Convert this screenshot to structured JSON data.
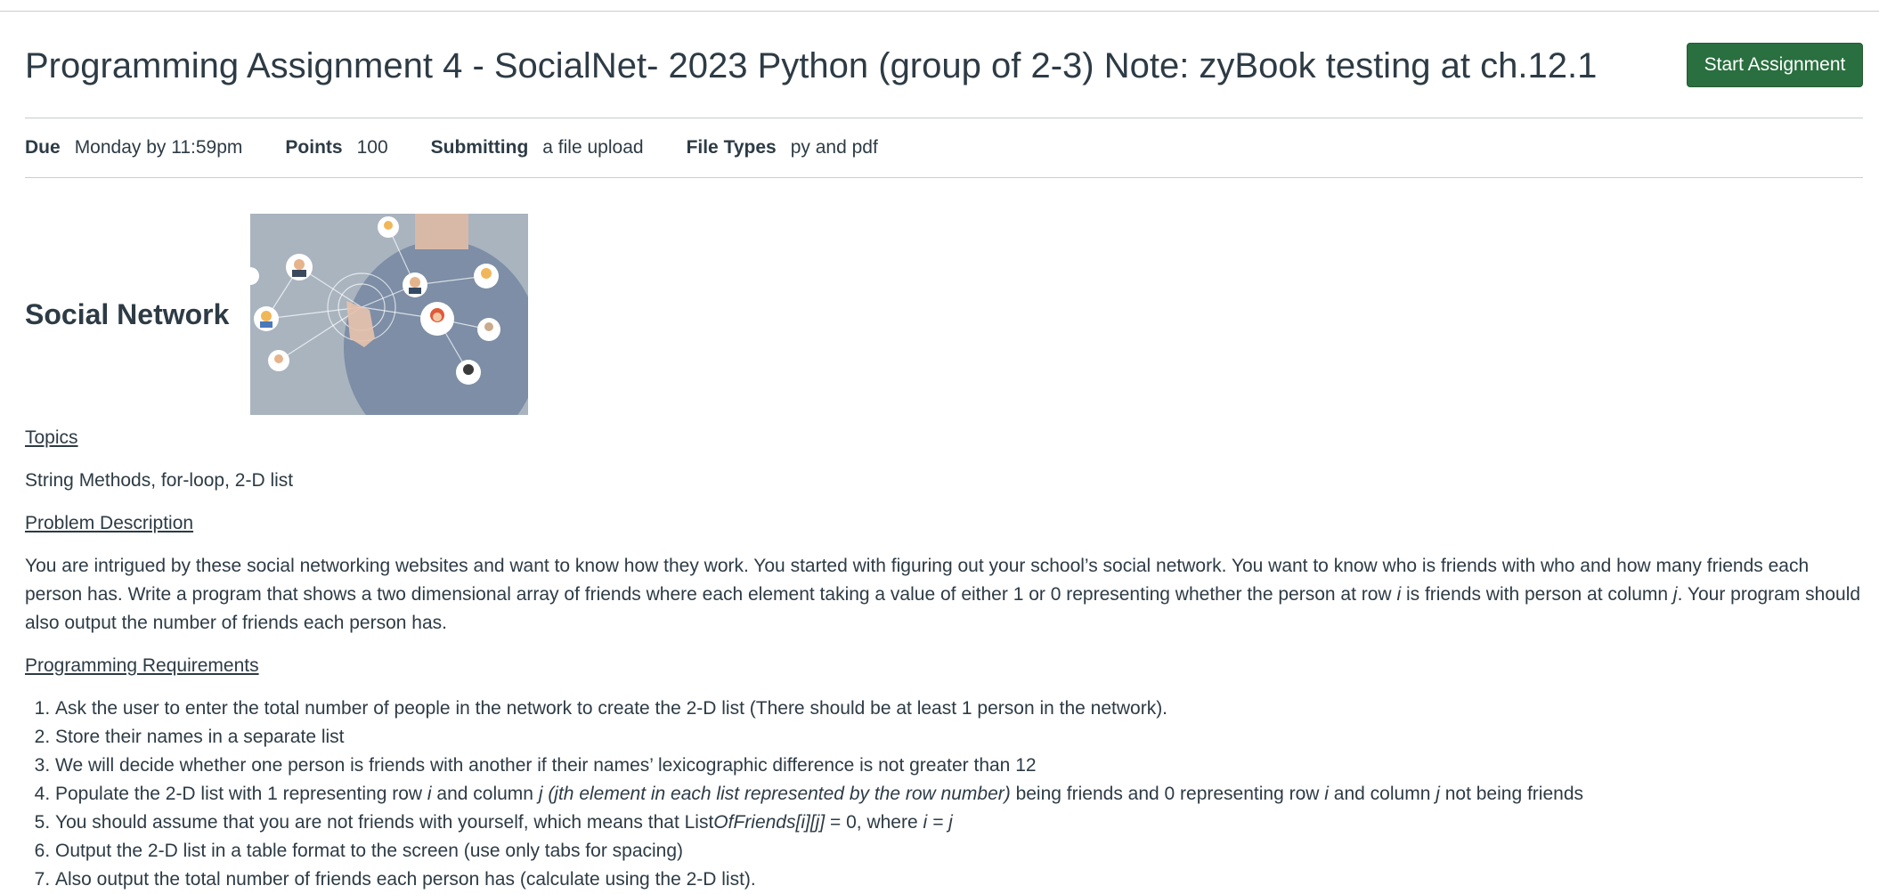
{
  "page": {
    "title": "Programming Assignment 4 - SocialNet- 2023 Python (group of 2-3) Note: zyBook testing at ch.12.1",
    "start_button": "Start Assignment"
  },
  "details": {
    "due_label": "Due",
    "due_value": "Monday by 11:59pm",
    "points_label": "Points",
    "points_value": "100",
    "submitting_label": "Submitting",
    "submitting_value": "a file upload",
    "filetypes_label": "File Types",
    "filetypes_value": "py and pdf"
  },
  "content": {
    "heading": "Social Network",
    "topics_heading": "Topics",
    "topics_text": "String Methods, for-loop, 2-D list",
    "problem_heading": "Problem Description",
    "problem_p1": "You are intrigued by these social networking websites and want to know how they work. You started with figuring out your school’s social network. You want to know who is friends with who and how many friends each person has. Write a program that shows a two dimensional array of friends where each element taking a value of either 1 or 0 representing whether the person at row ",
    "problem_i": "i",
    "problem_p2": " is friends with person at column ",
    "problem_j": "j",
    "problem_p3": ". Your program should also output the number of friends each person has.",
    "requirements_heading": "Programming Requirements",
    "req1": "Ask the user to enter the total number of people in the network to create the 2-D list (There should be at least 1 person in the network).",
    "req2": "Store their names in a separate list",
    "req3": "We will decide whether one person is friends with another if their names’ lexicographic difference is not greater than 12",
    "req4_a": "Populate the 2-D list with 1 representing row ",
    "req4_i": "i",
    "req4_b": " and column ",
    "req4_j": "j (jth element in each list represented by the row number)",
    "req4_c": " being friends and 0 representing row ",
    "req4_i2": "i",
    "req4_d": " and column ",
    "req4_j2": "j",
    "req4_e": " not being friends",
    "req5_a": "You should assume that you are not friends with yourself, which means that List",
    "req5_b": "OfFriends[i][j]",
    "req5_c": " = 0, where ",
    "req5_d": "i = j",
    "req6": "Output the 2-D list in a table format to the screen (use only tabs for spacing)",
    "req7": "Also output the total number of friends each person has (calculate using the 2-D list)."
  }
}
